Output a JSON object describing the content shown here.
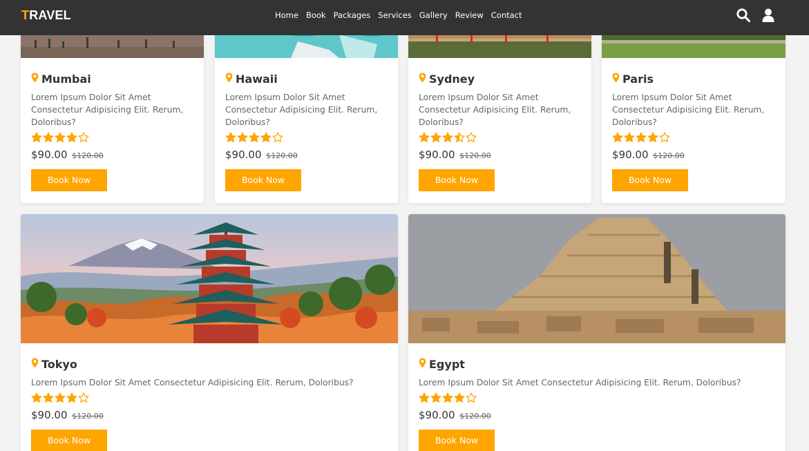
{
  "brand": {
    "first_letter": "T",
    "rest": "RAVEL"
  },
  "nav": [
    "Home",
    "Book",
    "Packages",
    "Services",
    "Gallery",
    "Review",
    "Contact"
  ],
  "icons": {
    "search": "search-icon",
    "user": "user-icon"
  },
  "accent_color": "#ffa500",
  "cards": [
    {
      "name": "Mumbai",
      "description": "Lorem Ipsum Dolor Sit Amet Consectetur Adipisicing Elit. Rerum, Doloribus?",
      "rating": 4,
      "price": "$90.00",
      "old_price": "$120.00",
      "button": "Book Now"
    },
    {
      "name": "Hawaii",
      "description": "Lorem Ipsum Dolor Sit Amet Consectetur Adipisicing Elit. Rerum, Doloribus?",
      "rating": 4,
      "price": "$90.00",
      "old_price": "$120.00",
      "button": "Book Now"
    },
    {
      "name": "Sydney",
      "description": "Lorem Ipsum Dolor Sit Amet Consectetur Adipisicing Elit. Rerum, Doloribus?",
      "rating": 3.5,
      "price": "$90.00",
      "old_price": "$120.00",
      "button": "Book Now"
    },
    {
      "name": "Paris",
      "description": "Lorem Ipsum Dolor Sit Amet Consectetur Adipisicing Elit. Rerum, Doloribus?",
      "rating": 4,
      "price": "$90.00",
      "old_price": "$120.00",
      "button": "Book Now"
    },
    {
      "name": "Tokyo",
      "description": "Lorem Ipsum Dolor Sit Amet Consectetur Adipisicing Elit. Rerum, Doloribus?",
      "rating": 4,
      "price": "$90.00",
      "old_price": "$120.00",
      "button": "Book Now"
    },
    {
      "name": "Egypt",
      "description": "Lorem Ipsum Dolor Sit Amet Consectetur Adipisicing Elit. Rerum, Doloribus?",
      "rating": 4,
      "price": "$90.00",
      "old_price": "$120.00",
      "button": "Book Now"
    }
  ]
}
